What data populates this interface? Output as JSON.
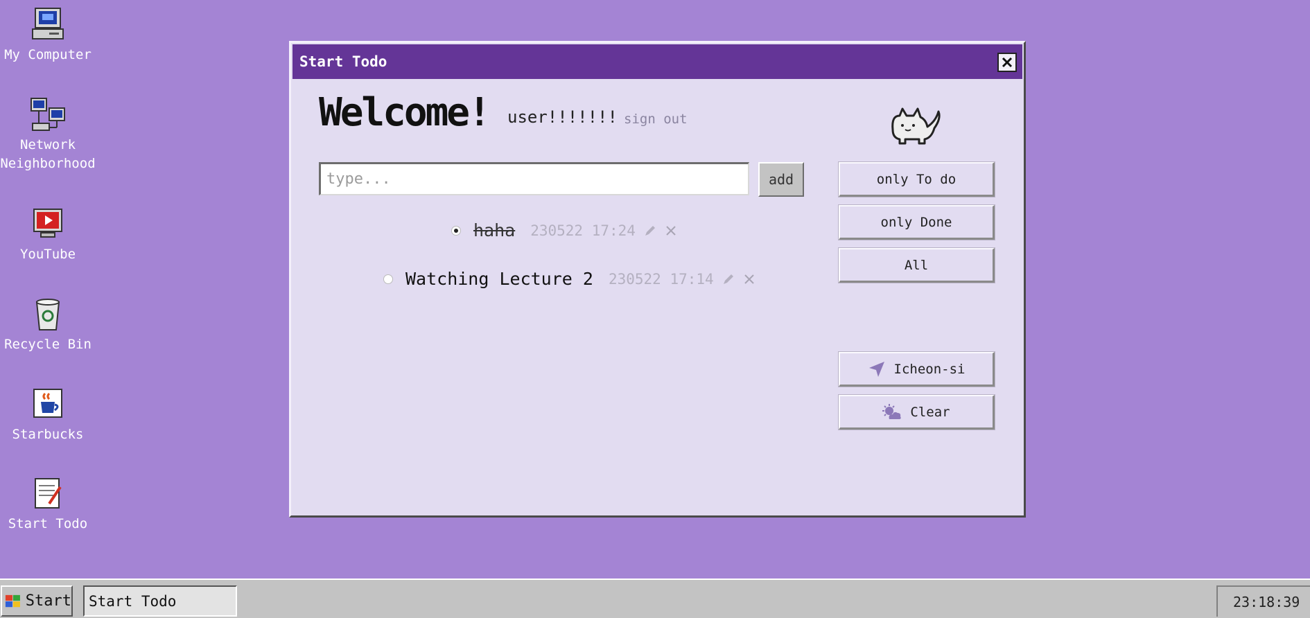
{
  "desktop": {
    "icons": [
      {
        "label": "My Computer",
        "icon": "computer-icon"
      },
      {
        "label": "Network Neighborhood",
        "icon": "network-icon"
      },
      {
        "label": "YouTube",
        "icon": "youtube-icon"
      },
      {
        "label": "Recycle Bin",
        "icon": "recycle-bin-icon"
      },
      {
        "label": "Starbucks",
        "icon": "coffee-icon"
      },
      {
        "label": "Start Todo",
        "icon": "notepad-icon"
      }
    ]
  },
  "window": {
    "title": "Start Todo",
    "welcome": "Welcome!",
    "username": "user!!!!!!!",
    "signout_label": "sign out",
    "input_placeholder": "type...",
    "add_label": "add",
    "todos": [
      {
        "text": "haha",
        "time": "230522 17:24",
        "done": true
      },
      {
        "text": "Watching Lecture 2",
        "time": "230522 17:14",
        "done": false
      }
    ],
    "filters": {
      "only_todo": "only To do",
      "only_done": "only Done",
      "all": "All"
    },
    "location": "Icheon-si",
    "weather": "Clear",
    "colors": {
      "titlebar": "#643597",
      "body": "#e2dcf1",
      "desktop": "#a484d4"
    }
  },
  "taskbar": {
    "start_label": "Start",
    "task_label": "Start Todo",
    "clock": "23:18:39"
  }
}
